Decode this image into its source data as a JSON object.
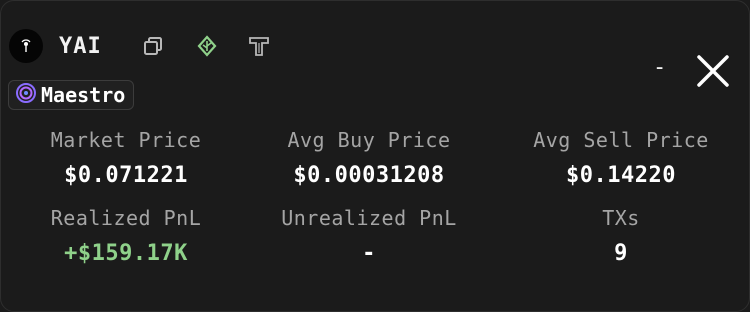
{
  "token": {
    "name": "YAI"
  },
  "badge": {
    "label": "Maestro"
  },
  "window": {
    "minimize_label": "-"
  },
  "stats": {
    "row1": [
      {
        "label": "Market Price",
        "value": "$0.071221"
      },
      {
        "label": "Avg Buy Price",
        "value": "$0.00031208"
      },
      {
        "label": "Avg Sell Price",
        "value": "$0.14220"
      }
    ],
    "row2": [
      {
        "label": "Realized PnL",
        "value": "+$159.17K"
      },
      {
        "label": "Unrealized PnL",
        "value": "-"
      },
      {
        "label": "TXs",
        "value": "9"
      }
    ]
  },
  "colors": {
    "positive": "#8fd18a",
    "leaf_icon": "#8fd18a",
    "badge_icon": "#8a6cff"
  },
  "icons": [
    "token-logo-icon",
    "copy-icon",
    "leaf-icon",
    "t-icon",
    "close-icon",
    "maestro-icon"
  ]
}
